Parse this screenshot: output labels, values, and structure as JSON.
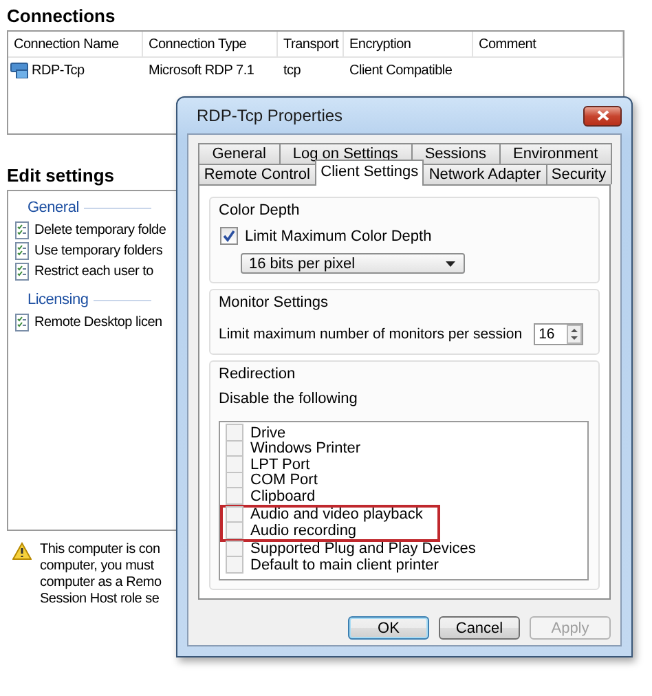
{
  "connections": {
    "title": "Connections",
    "columns": [
      "Connection Name",
      "Connection Type",
      "Transport",
      "Encryption",
      "Comment"
    ],
    "rows": [
      {
        "name": "RDP-Tcp",
        "type": "Microsoft RDP 7.1",
        "transport": "tcp",
        "encryption": "Client Compatible"
      }
    ]
  },
  "edit_settings": {
    "title": "Edit settings",
    "groups": [
      {
        "title": "General",
        "items": [
          "Delete temporary folde",
          "Use temporary folders",
          "Restrict each user to"
        ]
      },
      {
        "title": "Licensing",
        "items": [
          "Remote Desktop licen"
        ]
      }
    ]
  },
  "warning": {
    "lines": [
      "This computer is con",
      "computer, you must",
      "computer as a Remo",
      "Session Host role se"
    ]
  },
  "dialog": {
    "title": "RDP-Tcp Properties",
    "tab_rows": [
      [
        {
          "label": "General",
          "selected": false
        },
        {
          "label": "Log on Settings",
          "selected": false
        },
        {
          "label": "Sessions",
          "selected": false
        },
        {
          "label": "Environment",
          "selected": false
        }
      ],
      [
        {
          "label": "Remote Control",
          "selected": false
        },
        {
          "label": "Client Settings",
          "selected": true
        },
        {
          "label": "Network Adapter",
          "selected": false
        },
        {
          "label": "Security",
          "selected": false
        }
      ]
    ],
    "color_depth": {
      "title": "Color Depth",
      "checkbox": {
        "label": "Limit Maximum Color Depth",
        "checked": true
      },
      "dropdown": "16 bits per pixel"
    },
    "monitor": {
      "title": "Monitor Settings",
      "label": "Limit maximum number of monitors per session",
      "value": "16"
    },
    "redirection": {
      "title": "Redirection",
      "label": "Disable the following",
      "items": [
        {
          "label": "Drive",
          "checked": false,
          "highlighted": false
        },
        {
          "label": "Windows Printer",
          "checked": false,
          "highlighted": false
        },
        {
          "label": "LPT Port",
          "checked": false,
          "highlighted": false
        },
        {
          "label": "COM Port",
          "checked": false,
          "highlighted": false
        },
        {
          "label": "Clipboard",
          "checked": false,
          "highlighted": false
        },
        {
          "label": "Audio and video playback",
          "checked": false,
          "highlighted": true
        },
        {
          "label": "Audio recording",
          "checked": false,
          "highlighted": true
        },
        {
          "label": "Supported Plug and Play Devices",
          "checked": false,
          "highlighted": false
        },
        {
          "label": "Default to main client printer",
          "checked": false,
          "highlighted": false
        }
      ]
    },
    "buttons": [
      {
        "label": "OK",
        "default": true,
        "disabled": false
      },
      {
        "label": "Cancel",
        "default": false,
        "disabled": false
      },
      {
        "label": "Apply",
        "default": false,
        "disabled": true
      }
    ]
  }
}
